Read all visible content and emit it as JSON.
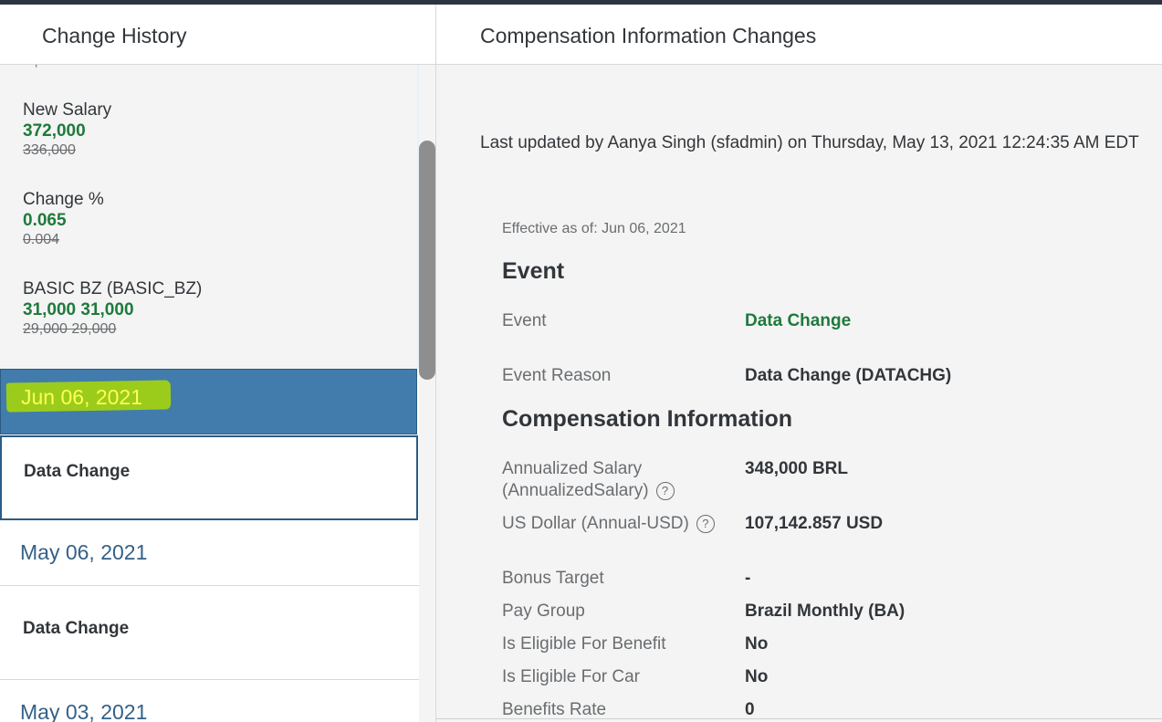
{
  "left_panel": {
    "title": "Change History",
    "detail_fields": [
      {
        "label": "New Salary",
        "new": "372,000",
        "old": "336,000"
      },
      {
        "label": "Change %",
        "new": "0.065",
        "old": "0.004"
      },
      {
        "label": "BASIC BZ (BASIC_BZ)",
        "new": "31,000 31,000",
        "old": "29,000 29,000"
      }
    ],
    "selected_date": "Jun 06, 2021",
    "selected_event": "Data Change",
    "items": [
      {
        "date": "May 06, 2021",
        "event": "Data Change"
      },
      {
        "date": "May 03, 2021"
      }
    ]
  },
  "right_panel": {
    "title": "Compensation Information Changes",
    "last_updated": "Last updated by Aanya Singh (sfadmin) on Thursday, May 13, 2021 12:24:35 AM EDT",
    "effective": "Effective as of: Jun 06, 2021",
    "event_section": {
      "title": "Event",
      "rows": [
        {
          "label": "Event",
          "value": "Data Change"
        },
        {
          "label": "Event Reason",
          "value": "Data Change (DATACHG)"
        }
      ]
    },
    "comp_section": {
      "title": "Compensation Information",
      "rows": [
        {
          "label": "Annualized Salary (AnnualizedSalary)",
          "value": "348,000 BRL"
        },
        {
          "label": "US Dollar (Annual-USD)",
          "value": "107,142.857 USD"
        },
        {
          "label": "Bonus Target",
          "value": "-"
        },
        {
          "label": "Pay Group",
          "value": "Brazil Monthly (BA)"
        },
        {
          "label": "Is Eligible For Benefit",
          "value": "No"
        },
        {
          "label": "Is Eligible For Car",
          "value": "No"
        },
        {
          "label": "Benefits Rate",
          "value": "0"
        }
      ]
    }
  },
  "colors": {
    "accent_green": "#1e7a3c",
    "selected_blue": "#427cac",
    "link_blue": "#346187",
    "highlight": "#9ccc1b"
  }
}
